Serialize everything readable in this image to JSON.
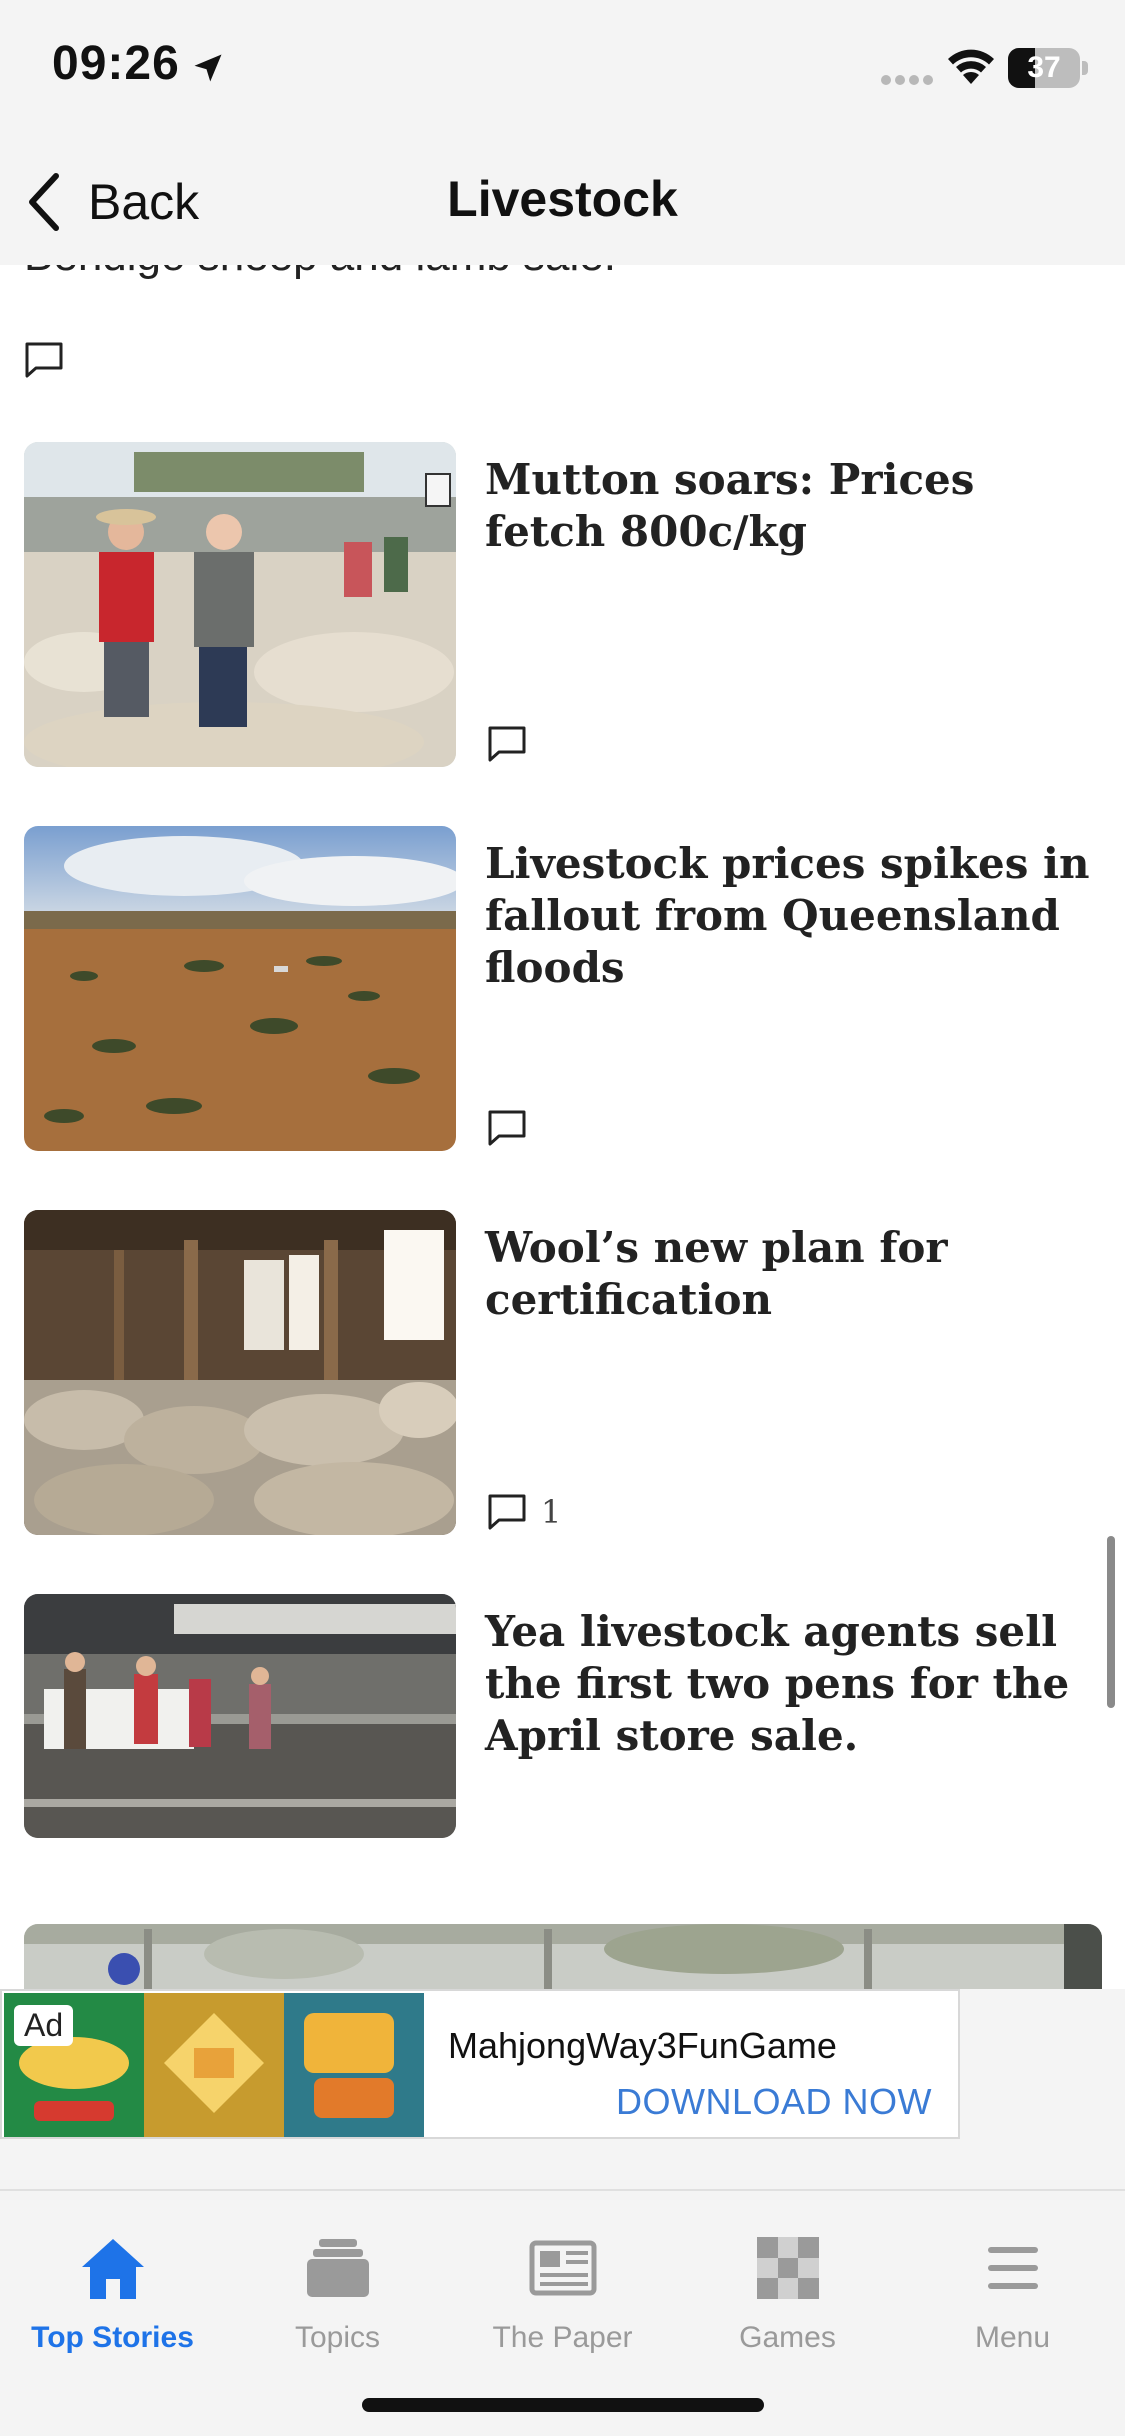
{
  "status_bar": {
    "time": "09:26",
    "battery_level": "37",
    "battery_fraction": 0.37
  },
  "nav": {
    "back_label": "Back",
    "title": "Livestock"
  },
  "cut_off_text": "Bendigo sheep and lamb sale.",
  "articles": [
    {
      "headline": "Mutton soars: Prices fetch 800c/kg",
      "comments": ""
    },
    {
      "headline": "Livestock prices spikes in fallout from Queensland floods",
      "comments": ""
    },
    {
      "headline": "Wool’s new plan for certification",
      "comments": "1"
    },
    {
      "headline": "Yea livestock agents sell the first two pens for the April store sale.",
      "comments": ""
    }
  ],
  "ad": {
    "badge": "Ad",
    "title": "MahjongWay3FunGame",
    "cta": "DOWNLOAD NOW"
  },
  "tabs": [
    {
      "label": "Top Stories",
      "icon": "home-icon",
      "active": true
    },
    {
      "label": "Topics",
      "icon": "topics-stack-icon",
      "active": false
    },
    {
      "label": "The Paper",
      "icon": "newspaper-icon",
      "active": false
    },
    {
      "label": "Games",
      "icon": "checkerboard-icon",
      "active": false
    },
    {
      "label": "Menu",
      "icon": "hamburger-menu-icon",
      "active": false
    }
  ],
  "colors": {
    "accent": "#1e73e8",
    "tab_inactive": "#9a9a9a",
    "ad_cta": "#3a7bd5",
    "bar_background": "#f4f4f4"
  }
}
